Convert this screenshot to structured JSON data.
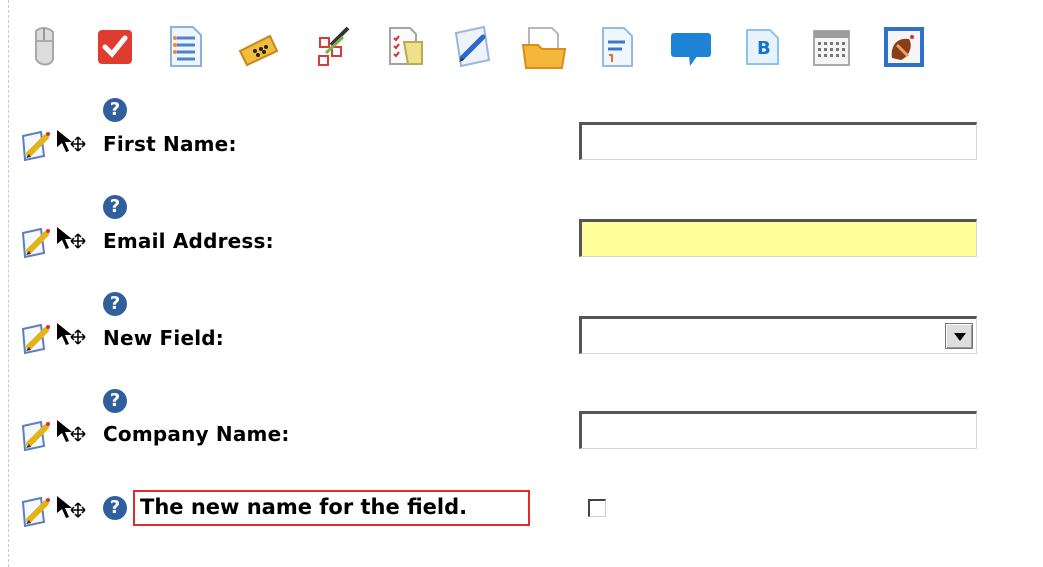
{
  "toolbar": {
    "icons": [
      {
        "name": "mouse-icon"
      },
      {
        "name": "checkbox-icon"
      },
      {
        "name": "numbered-list-icon"
      },
      {
        "name": "password-field-icon"
      },
      {
        "name": "cut-copy-icon"
      },
      {
        "name": "checklist-doc-icon"
      },
      {
        "name": "pen-edit-icon"
      },
      {
        "name": "folder-files-icon"
      },
      {
        "name": "text-document-icon"
      },
      {
        "name": "speech-bubble-icon"
      },
      {
        "name": "bold-text-icon"
      },
      {
        "name": "calendar-icon"
      },
      {
        "name": "image-stamp-icon"
      }
    ]
  },
  "form": {
    "fields": [
      {
        "label": "First Name:",
        "value": "",
        "type": "text"
      },
      {
        "label": "Email Address:",
        "value": "",
        "type": "text",
        "highlighted": true
      },
      {
        "label": "New Field:",
        "value": "",
        "type": "select"
      },
      {
        "label": "Company Name:",
        "value": "",
        "type": "text"
      }
    ],
    "editing_row": {
      "label_value": "The new name for the field.",
      "checkbox_checked": false
    }
  },
  "colors": {
    "highlight": "#ffff99",
    "edit_border": "#e42b2b",
    "help_icon": "#2f5f9c"
  }
}
